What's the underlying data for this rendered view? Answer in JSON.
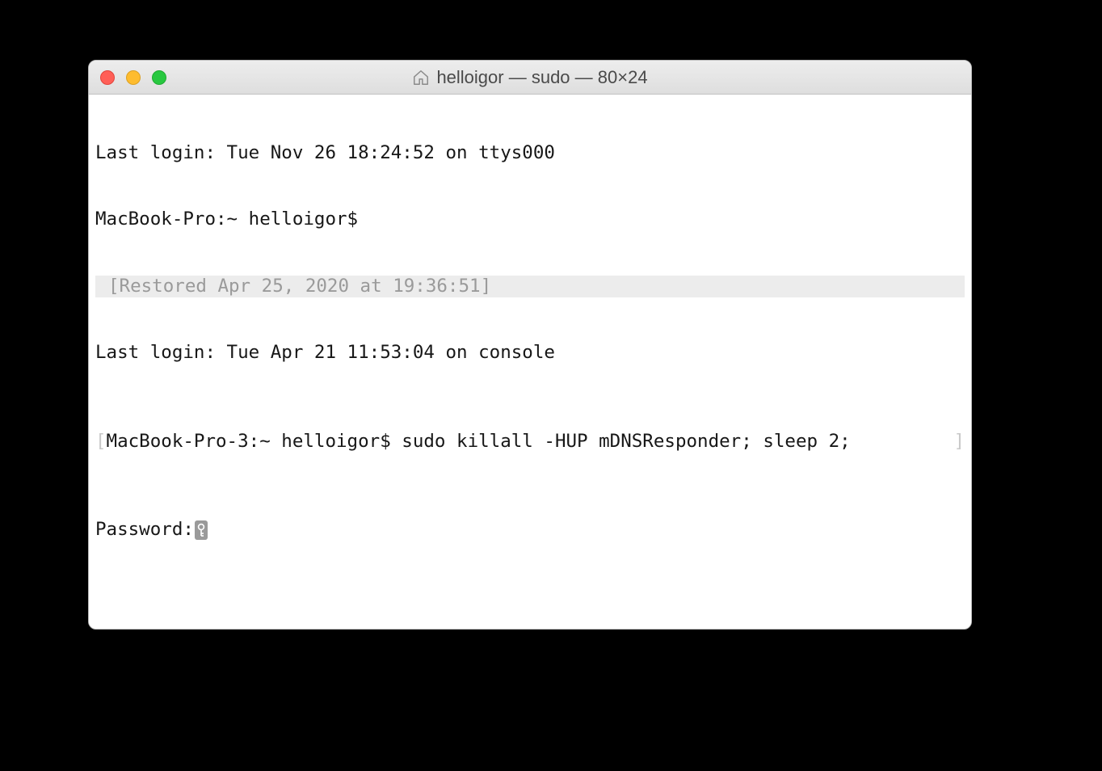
{
  "window": {
    "title": "helloigor — sudo — 80×24"
  },
  "terminal": {
    "line1": "Last login: Tue Nov 26 18:24:52 on ttys000",
    "line2": "MacBook-Pro:~ helloigor$",
    "restored": "[Restored Apr 25, 2020 at 19:36:51]",
    "line3": "Last login: Tue Apr 21 11:53:04 on console",
    "bracket_open": "[",
    "prompt2": "MacBook-Pro-3:~ helloigor$ ",
    "command": "sudo killall -HUP mDNSResponder; sleep 2;",
    "bracket_close": "]",
    "password_label": "Password:"
  }
}
